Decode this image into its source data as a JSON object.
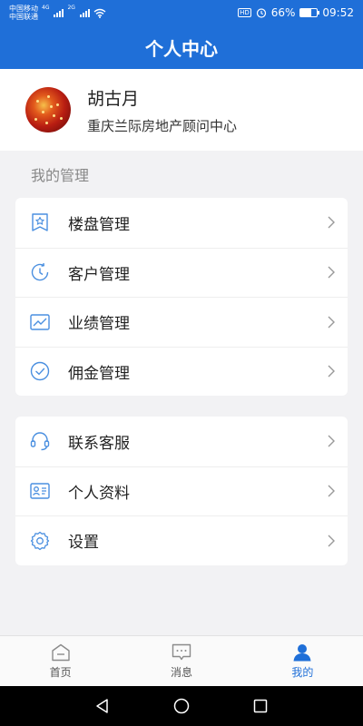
{
  "status_bar": {
    "carrier_1": "中国移动",
    "carrier_2": "中国联通",
    "net_1": "4G",
    "net_2": "2G",
    "hd": "HD",
    "battery": "66%",
    "time": "09:52"
  },
  "header": {
    "title": "个人中心"
  },
  "profile": {
    "name": "胡古月",
    "organization": "重庆兰际房地产顾问中心"
  },
  "management": {
    "section_title": "我的管理",
    "items": [
      {
        "label": "楼盘管理",
        "icon": "building-badge-icon"
      },
      {
        "label": "客户管理",
        "icon": "clock-icon"
      },
      {
        "label": "业绩管理",
        "icon": "trend-chart-icon"
      },
      {
        "label": "佣金管理",
        "icon": "check-circle-icon"
      }
    ]
  },
  "other": {
    "items": [
      {
        "label": "联系客服",
        "icon": "headset-icon"
      },
      {
        "label": "个人资料",
        "icon": "id-card-icon"
      },
      {
        "label": "设置",
        "icon": "gear-icon"
      }
    ]
  },
  "tabbar": {
    "tabs": [
      {
        "label": "首页",
        "icon": "home-icon"
      },
      {
        "label": "消息",
        "icon": "message-icon"
      },
      {
        "label": "我的",
        "icon": "person-icon",
        "active": true
      }
    ]
  },
  "colors": {
    "primary": "#1f6fd8",
    "icon": "#4a8fe0",
    "background": "#f2f2f4"
  }
}
